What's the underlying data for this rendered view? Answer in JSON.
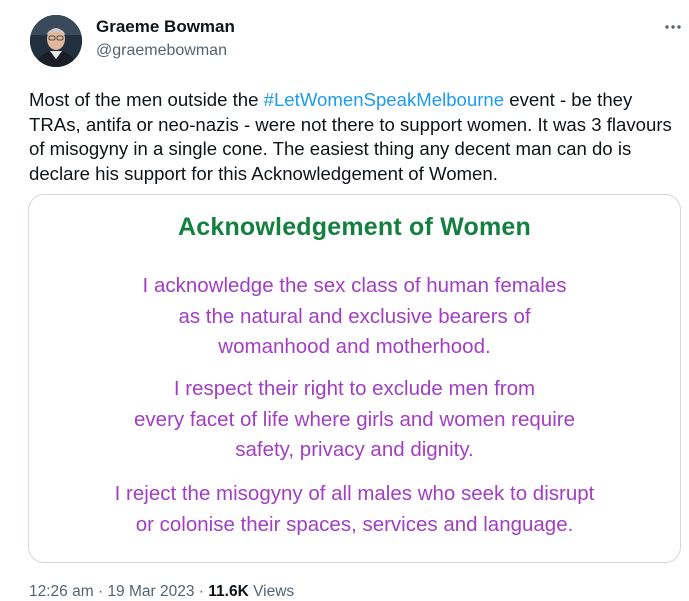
{
  "author": {
    "name": "Graeme Bowman",
    "handle": "@graemebowman",
    "avatar_icon": "profile-photo"
  },
  "menu_icon": "more-horizontal-icon",
  "tweet": {
    "text_before": "Most of the men outside the ",
    "hashtag": "#LetWomenSpeakMelbourne",
    "text_after": " event - be they TRAs, antifa or neo-nazis - were not there to support women. It was 3 flavours of misogyny in a single cone. The easiest thing any decent man can do is declare his support for this Acknowledgement of Women."
  },
  "image": {
    "title": "Acknowledgement of Women",
    "paragraph1": [
      "I acknowledge the sex class of human females",
      "as the natural and exclusive bearers of",
      "womanhood and motherhood."
    ],
    "paragraph2": [
      "I respect their right to exclude men from",
      "every facet of life where girls and women require",
      "safety, privacy and dignity."
    ],
    "paragraph3": [
      "I reject the misogyny of all males who seek to disrupt",
      "or colonise their spaces, services and language."
    ]
  },
  "meta": {
    "time": "12:26 am",
    "separator": "·",
    "date": "19 Mar 2023",
    "views_count": "11.6K",
    "views_label": "Views"
  },
  "colors": {
    "hashtag": "#1d9bf0",
    "title_green": "#13803f",
    "text_purple": "#a23ec4",
    "secondary": "#536471"
  }
}
